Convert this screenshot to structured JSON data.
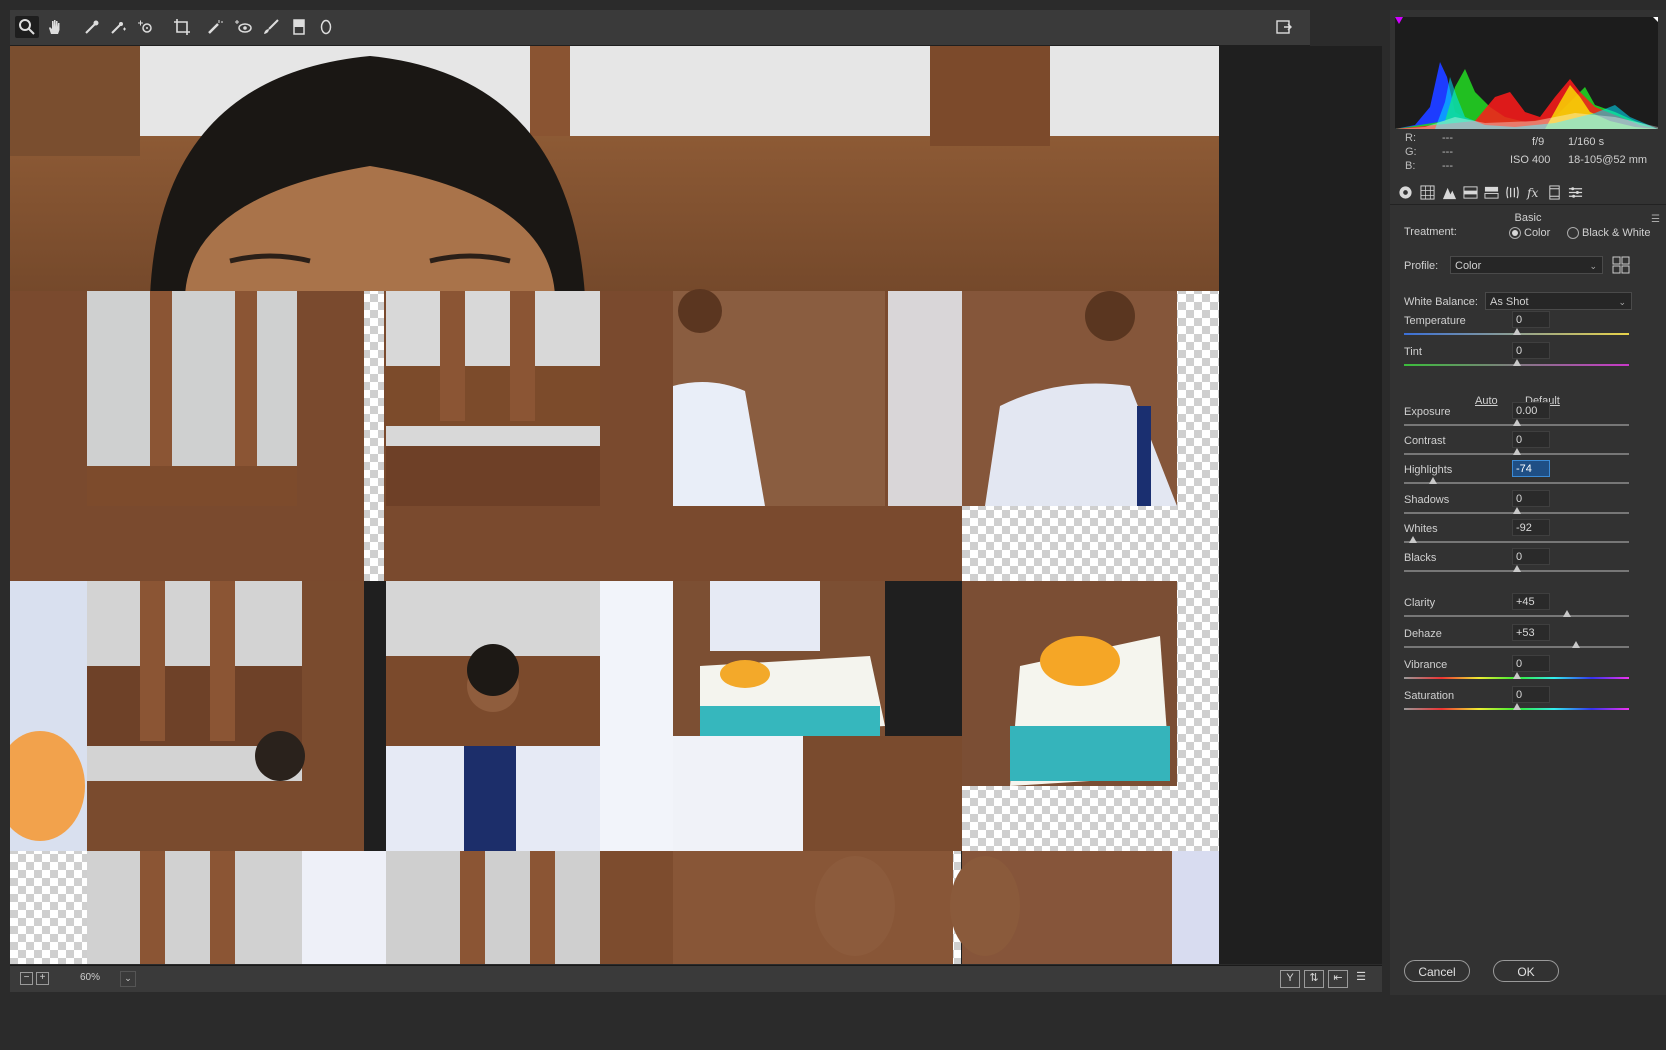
{
  "toolbar": {
    "tools": [
      "zoom-icon",
      "hand-icon",
      "white-balance-icon",
      "color-sampler-icon",
      "targeted-adjustment-icon",
      "crop-icon",
      "spot-removal-icon",
      "red-eye-icon",
      "adjustment-brush-icon",
      "graduated-filter-icon",
      "radial-filter-icon"
    ],
    "open_preferences": "preferences-icon"
  },
  "footer": {
    "zoom": "60%",
    "cancel": "Cancel",
    "ok": "OK"
  },
  "info": {
    "r_label": "R:",
    "g_label": "G:",
    "b_label": "B:",
    "r": "---",
    "g": "---",
    "b": "---",
    "aperture": "f/9",
    "shutter": "1/160 s",
    "iso": "ISO 400",
    "lens": "18-105@52 mm"
  },
  "panel": {
    "title": "Basic",
    "treatment_label": "Treatment:",
    "treatment_color": "Color",
    "treatment_bw": "Black & White",
    "profile_label": "Profile:",
    "profile_value": "Color",
    "wb_label": "White Balance:",
    "wb_value": "As Shot",
    "auto": "Auto",
    "default": "Default",
    "sliders": [
      {
        "name": "Temperature",
        "value": "0",
        "pos": 0.5
      },
      {
        "name": "Tint",
        "value": "0",
        "pos": 0.5
      },
      {
        "name": "Exposure",
        "value": "0.00",
        "pos": 0.5
      },
      {
        "name": "Contrast",
        "value": "0",
        "pos": 0.5
      },
      {
        "name": "Highlights",
        "value": "-74",
        "pos": 0.13
      },
      {
        "name": "Shadows",
        "value": "0",
        "pos": 0.5
      },
      {
        "name": "Whites",
        "value": "-92",
        "pos": 0.04
      },
      {
        "name": "Blacks",
        "value": "0",
        "pos": 0.5
      },
      {
        "name": "Clarity",
        "value": "+45",
        "pos": 0.725
      },
      {
        "name": "Dehaze",
        "value": "+53",
        "pos": 0.765
      },
      {
        "name": "Vibrance",
        "value": "0",
        "pos": 0.5
      },
      {
        "name": "Saturation",
        "value": "0",
        "pos": 0.5
      }
    ]
  },
  "colors": {
    "panel_bg": "#323232",
    "canvas_bg": "#1f1f1f",
    "accent": "#3b8bd6"
  }
}
